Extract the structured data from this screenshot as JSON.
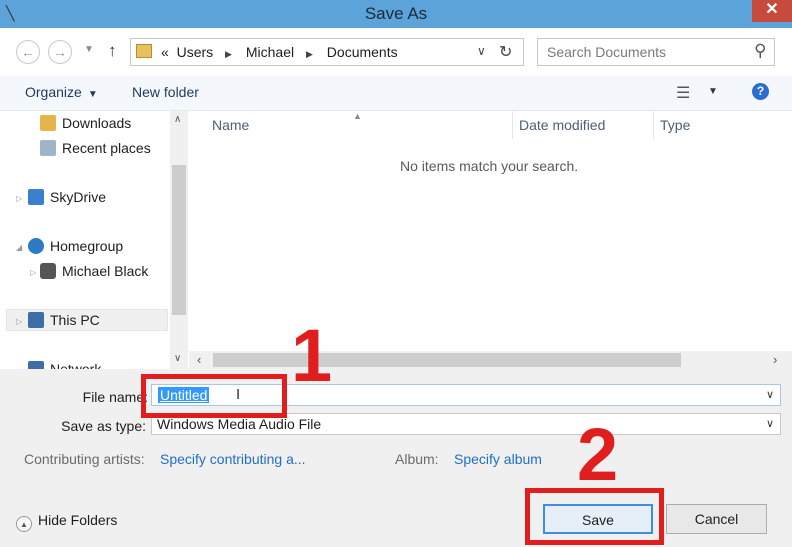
{
  "window": {
    "title": "Save As",
    "close": "✕"
  },
  "address": {
    "overflow": "«",
    "crumbs": [
      "Users",
      "Michael",
      "Documents"
    ],
    "separator": "▶"
  },
  "search": {
    "placeholder": "Search Documents"
  },
  "toolbar": {
    "organize": "Organize",
    "new_folder": "New folder"
  },
  "nav": {
    "items": [
      {
        "label": "Downloads"
      },
      {
        "label": "Recent places"
      },
      {
        "label": "SkyDrive"
      },
      {
        "label": "Homegroup"
      },
      {
        "label": "Michael Black"
      },
      {
        "label": "This PC"
      },
      {
        "label": "Network"
      }
    ]
  },
  "columns": [
    "Name",
    "Date modified",
    "Type"
  ],
  "empty_message": "No items match your search.",
  "form": {
    "file_name_label": "File name:",
    "file_name_value": "Untitled",
    "save_type_label": "Save as type:",
    "save_type_value": "Windows Media Audio File",
    "artists_label": "Contributing artists:",
    "artists_value": "Specify contributing a...",
    "album_label": "Album:",
    "album_value": "Specify album"
  },
  "footer": {
    "hide_folders": "Hide Folders",
    "save": "Save",
    "cancel": "Cancel"
  },
  "annotations": {
    "step1": "1",
    "step2": "2"
  },
  "colors": {
    "annotation": "#e01e1e",
    "titlebar": "#5ba3d8",
    "link": "#1f6fc5",
    "selection": "#3399ff"
  }
}
